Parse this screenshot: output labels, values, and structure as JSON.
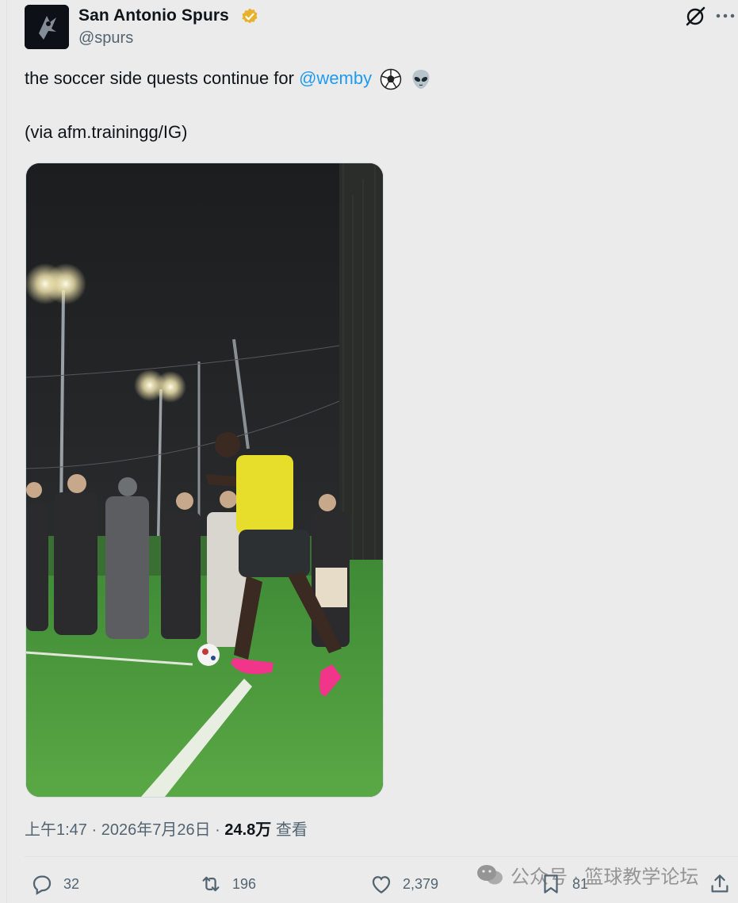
{
  "account": {
    "name": "San Antonio Spurs",
    "handle": "@spurs",
    "verified": true,
    "badge_color": "#e8b02c"
  },
  "tweet": {
    "text_before": "the soccer side quests continue for ",
    "mention": "@wemby",
    "emojis": [
      "soccer-ball-icon",
      "alien-icon"
    ],
    "source_line": "(via afm.trainingg/IG)"
  },
  "media": {
    "type": "video",
    "description_icon": "soccer-video-thumbnail"
  },
  "meta": {
    "time": "上午1:47",
    "separator": " · ",
    "date": "2026年7月26日",
    "views_count": "24.8万",
    "views_label": " 查看"
  },
  "actions": {
    "replies": "32",
    "retweets": "196",
    "likes": "2,379",
    "bookmarks": "81"
  },
  "watermark": {
    "text": "公众号 · 篮球教学论坛"
  },
  "colors": {
    "link": "#1d9bf0",
    "muted": "#536471",
    "background": "#ebebeb"
  }
}
